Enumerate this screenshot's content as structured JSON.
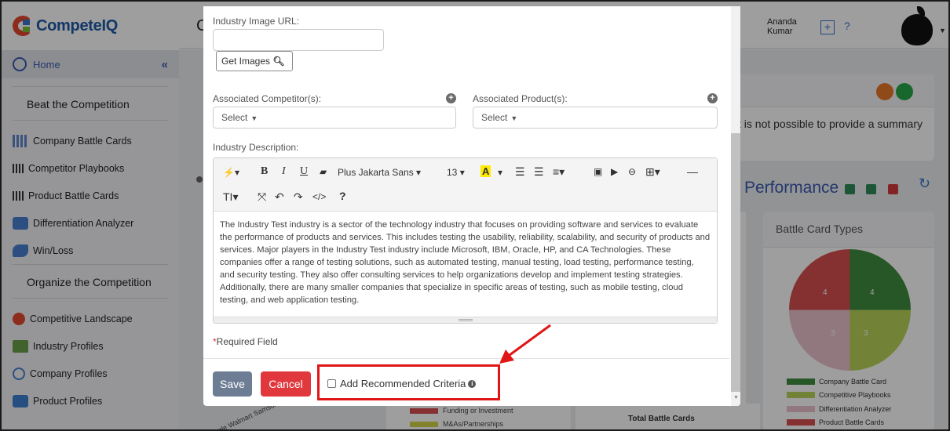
{
  "brand": {
    "name": "CompeteIQ"
  },
  "sidebar": {
    "home_label": "Home",
    "collapse_glyph": "«",
    "sections": [
      {
        "title": "Beat the Competition",
        "items": [
          {
            "label": "Company Battle Cards",
            "icon": "building-icon"
          },
          {
            "label": "Competitor Playbooks",
            "icon": "barcode-icon"
          },
          {
            "label": "Product Battle Cards",
            "icon": "barcode-icon"
          },
          {
            "label": "Differentiation Analyzer",
            "icon": "chart-icon"
          },
          {
            "label": "Win/Loss",
            "icon": "handshake-icon"
          }
        ]
      },
      {
        "title": "Organize the Competition",
        "items": [
          {
            "label": "Competitive Landscape",
            "icon": "landscape-icon"
          },
          {
            "label": "Industry Profiles",
            "icon": "industry-icon"
          },
          {
            "label": "Company Profiles",
            "icon": "globe-icon"
          },
          {
            "label": "Product Profiles",
            "icon": "cube-icon"
          }
        ]
      }
    ]
  },
  "header": {
    "page_letter": "C",
    "user_first": "Ananda",
    "user_last": "Kumar",
    "plus": "+",
    "help": "?"
  },
  "background": {
    "summary_text": "t is not possible to provide a summary",
    "performance_title": "Performance",
    "battle_card_types_title": "Battle Card Types",
    "pie": {
      "slices": [
        {
          "label": "Company Battle Card",
          "value": 4,
          "color": "#3f8b3f"
        },
        {
          "label": "Competitive Playbooks",
          "value": 3,
          "color": "#b8d45a"
        },
        {
          "label": "Differentiation Analyzer",
          "value": 3,
          "color": "#e8c2cc"
        },
        {
          "label": "Product Battle Cards",
          "value": 4,
          "color": "#d85050"
        }
      ]
    },
    "bottom_axis_labels": "Google  Walmart  Samsung  Apple  Xiaomi",
    "legend_mid": [
      "Funding or Investment",
      "M&As/Partnerships"
    ],
    "total_battle_cards": "Total Battle Cards"
  },
  "modal": {
    "industry_image_url_label": "Industry Image URL:",
    "industry_image_url_value": "",
    "get_images_label": "Get Images",
    "associated_competitors_label": "Associated Competitor(s):",
    "associated_products_label": "Associated Product(s):",
    "select_placeholder": "Select",
    "industry_description_label": "Industry Description:",
    "toolbar": {
      "font_family": "Plus Jakarta Sans",
      "font_size": "13",
      "bold": "B",
      "italic": "I",
      "underline": "U",
      "text_transform": "TI",
      "code": "</>",
      "help": "?"
    },
    "description_text": "The Industry Test industry is a sector of the technology industry that focuses on providing software and services to evaluate the performance of products and services. This includes testing the usability, reliability, scalability, and security of products and services. Major players in the Industry Test industry include Microsoft, IBM, Oracle, HP, and CA Technologies. These companies offer a range of testing solutions, such as automated testing, manual testing, load testing, performance testing, and security testing. They also offer consulting services to help organizations develop and implement testing strategies. Additionally, there are many smaller companies that specialize in specific areas of testing, such as mobile testing, cloud testing, and web application testing.",
    "required_star": "*",
    "required_label": "Required Field",
    "save_label": "Save",
    "cancel_label": "Cancel",
    "add_criteria_label": "Add Recommended Criteria"
  },
  "colors": {
    "brand_blue": "#1e5aa8",
    "cancel_red": "#e0383d",
    "save_gray": "#6c7d94",
    "annotation_red": "#e01616"
  }
}
